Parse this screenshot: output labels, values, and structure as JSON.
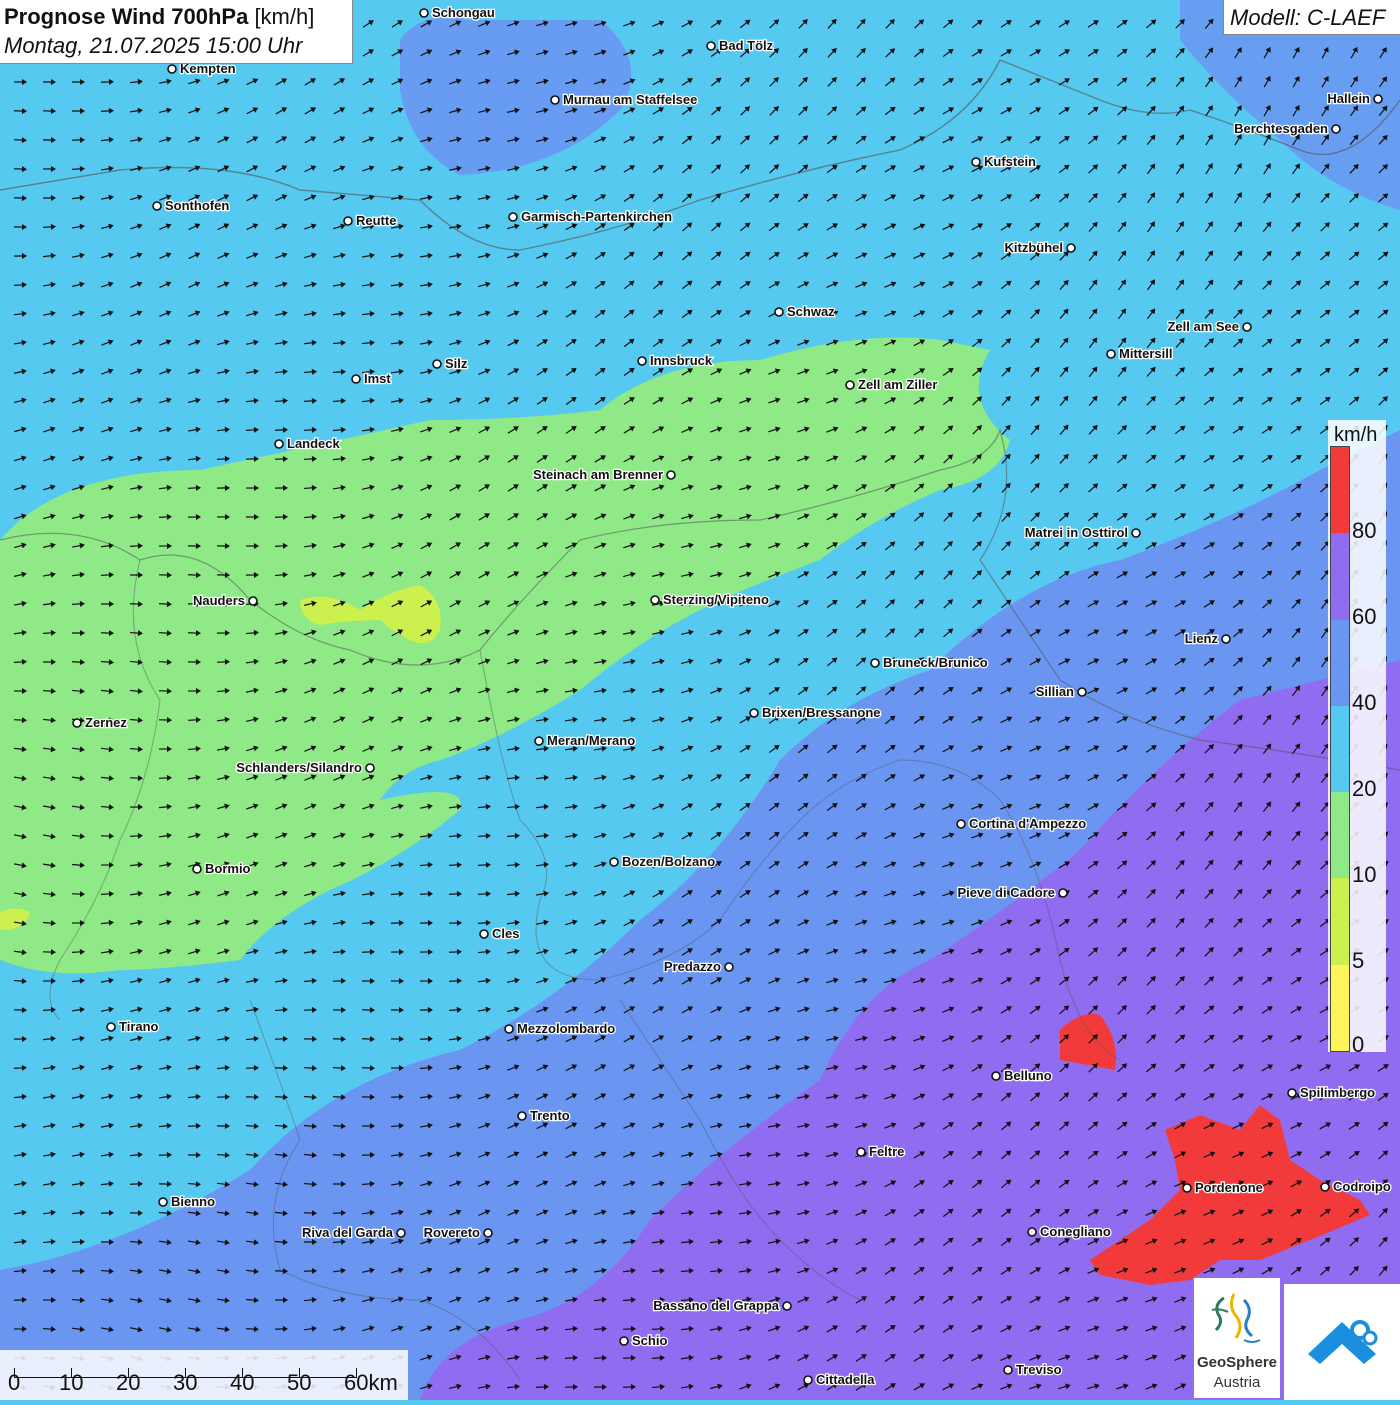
{
  "header": {
    "title_bold": "Prognose Wind 700hPa",
    "title_unit": "[km/h]",
    "datetime": "Montag, 21.07.2025 15:00 Uhr"
  },
  "model": "Modell: C-LAEF",
  "legend": {
    "unit": "km/h",
    "labels": [
      "80",
      "60",
      "40",
      "20",
      "10",
      "5",
      "0"
    ],
    "colors": [
      "#f23a3a",
      "#8f6cf0",
      "#6a96f2",
      "#56c9f0",
      "#8ee986",
      "#ccf04e",
      "#fff35a"
    ]
  },
  "scale": {
    "labels": [
      "0",
      "10",
      "20",
      "30",
      "40",
      "50",
      "60km"
    ]
  },
  "logo": {
    "brand_line1": "GeoSphere",
    "brand_line2": "Austria"
  },
  "map_colors": {
    "wind_20_40": "#56c9f0",
    "wind_10_20": "#8ee986",
    "wind_5_10": "#ccf04e",
    "wind_40_60": "#6a96f2",
    "wind_60_80": "#8f6cf0",
    "wind_80_plus": "#f23a3a"
  },
  "cities": [
    {
      "name": "Schongau"
    },
    {
      "name": "Kempten"
    },
    {
      "name": "Bad Tölz"
    },
    {
      "name": "Murnau am Staffelsee"
    },
    {
      "name": "Hallein"
    },
    {
      "name": "Berchtesgaden"
    },
    {
      "name": "Kufstein"
    },
    {
      "name": "Sonthofen"
    },
    {
      "name": "Reutte"
    },
    {
      "name": "Garmisch-Partenkirchen"
    },
    {
      "name": "Kitzbühel"
    },
    {
      "name": "Schwaz"
    },
    {
      "name": "Zell am See"
    },
    {
      "name": "Mittersill"
    },
    {
      "name": "Imst"
    },
    {
      "name": "Silz"
    },
    {
      "name": "Innsbruck"
    },
    {
      "name": "Zell am Ziller"
    },
    {
      "name": "Landeck"
    },
    {
      "name": "Steinach am Brenner"
    },
    {
      "name": "Matrei in Osttirol"
    },
    {
      "name": "Nauders"
    },
    {
      "name": "Sterzing/Vipiteno"
    },
    {
      "name": "Lienz"
    },
    {
      "name": "Bruneck/Brunico"
    },
    {
      "name": "Sillian"
    },
    {
      "name": "Brixen/Bressanone"
    },
    {
      "name": "Zernez"
    },
    {
      "name": "Meran/Merano"
    },
    {
      "name": "Schlanders/Silandro"
    },
    {
      "name": "Cortina d'Ampezzo"
    },
    {
      "name": "Bormio"
    },
    {
      "name": "Bozen/Bolzano"
    },
    {
      "name": "Pieve di Cadore"
    },
    {
      "name": "Cles"
    },
    {
      "name": "Predazzo"
    },
    {
      "name": "Tirano"
    },
    {
      "name": "Mezzolombardo"
    },
    {
      "name": "Belluno"
    },
    {
      "name": "Spilimbergo"
    },
    {
      "name": "Trento"
    },
    {
      "name": "Feltre"
    },
    {
      "name": "Pordenone"
    },
    {
      "name": "Codroipo"
    },
    {
      "name": "Bienno"
    },
    {
      "name": "Riva del Garda"
    },
    {
      "name": "Rovereto"
    },
    {
      "name": "Conegliano"
    },
    {
      "name": "Bassano del Grappa"
    },
    {
      "name": "Schio"
    },
    {
      "name": "Treviso"
    },
    {
      "name": "Cittadella"
    }
  ]
}
